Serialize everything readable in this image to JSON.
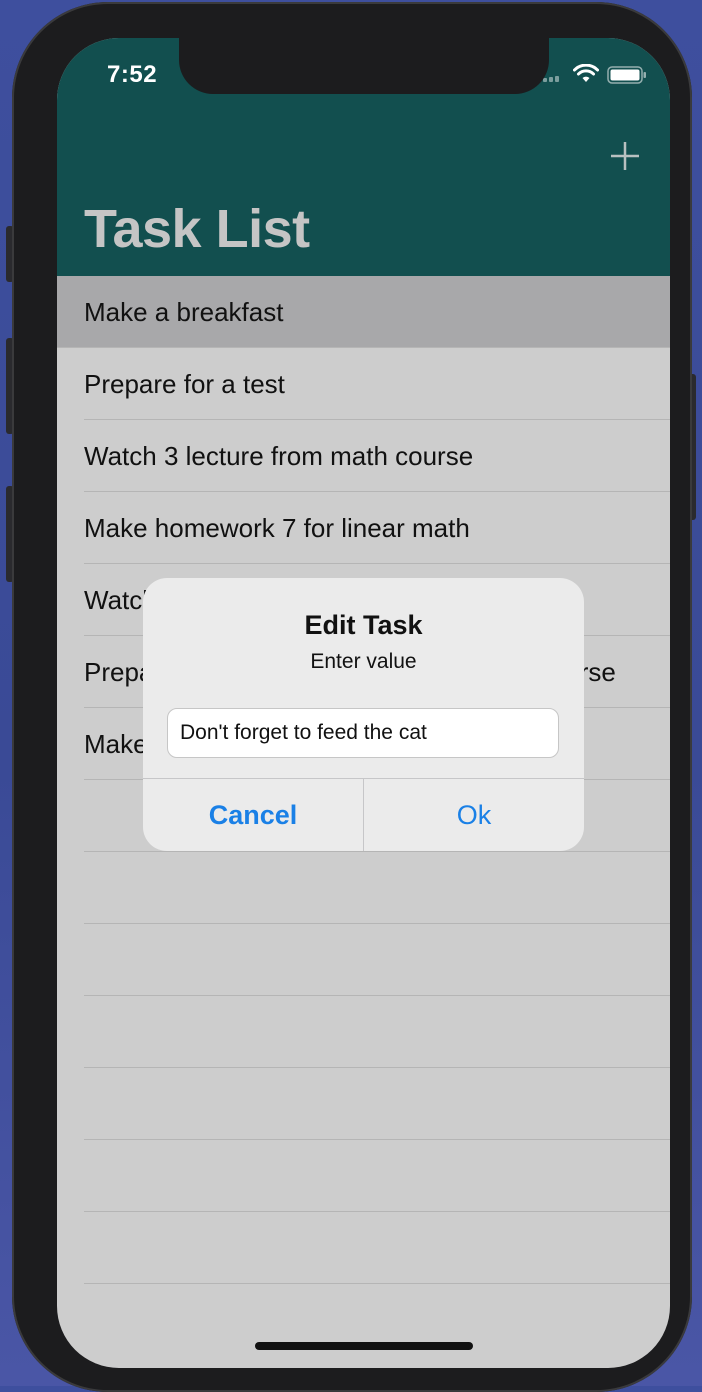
{
  "status": {
    "time": "7:52"
  },
  "nav": {
    "title": "Task List",
    "add_icon": "plus-icon"
  },
  "tasks": [
    {
      "label": "Make a breakfast",
      "selected": true
    },
    {
      "label": "Prepare for a test"
    },
    {
      "label": "Watch 3 lecture from math course"
    },
    {
      "label": "Make homework 7 for linear math"
    },
    {
      "label": "Watch 2 lecture from physics course"
    },
    {
      "label": "Prepare for a quiz on the programming course"
    },
    {
      "label": "Make a breakfast"
    },
    {
      "label": ""
    },
    {
      "label": ""
    },
    {
      "label": ""
    },
    {
      "label": ""
    },
    {
      "label": ""
    },
    {
      "label": ""
    },
    {
      "label": ""
    }
  ],
  "alert": {
    "title": "Edit Task",
    "message": "Enter value",
    "input_value": "Don't forget to feed the cat",
    "cancel_label": "Cancel",
    "ok_label": "Ok"
  },
  "colors": {
    "navbar": "#124f4f",
    "title": "#c5c5c5",
    "accent": "#1a80e6",
    "list_bg": "#cdcdcd",
    "selected_row": "#a8a8aa"
  }
}
